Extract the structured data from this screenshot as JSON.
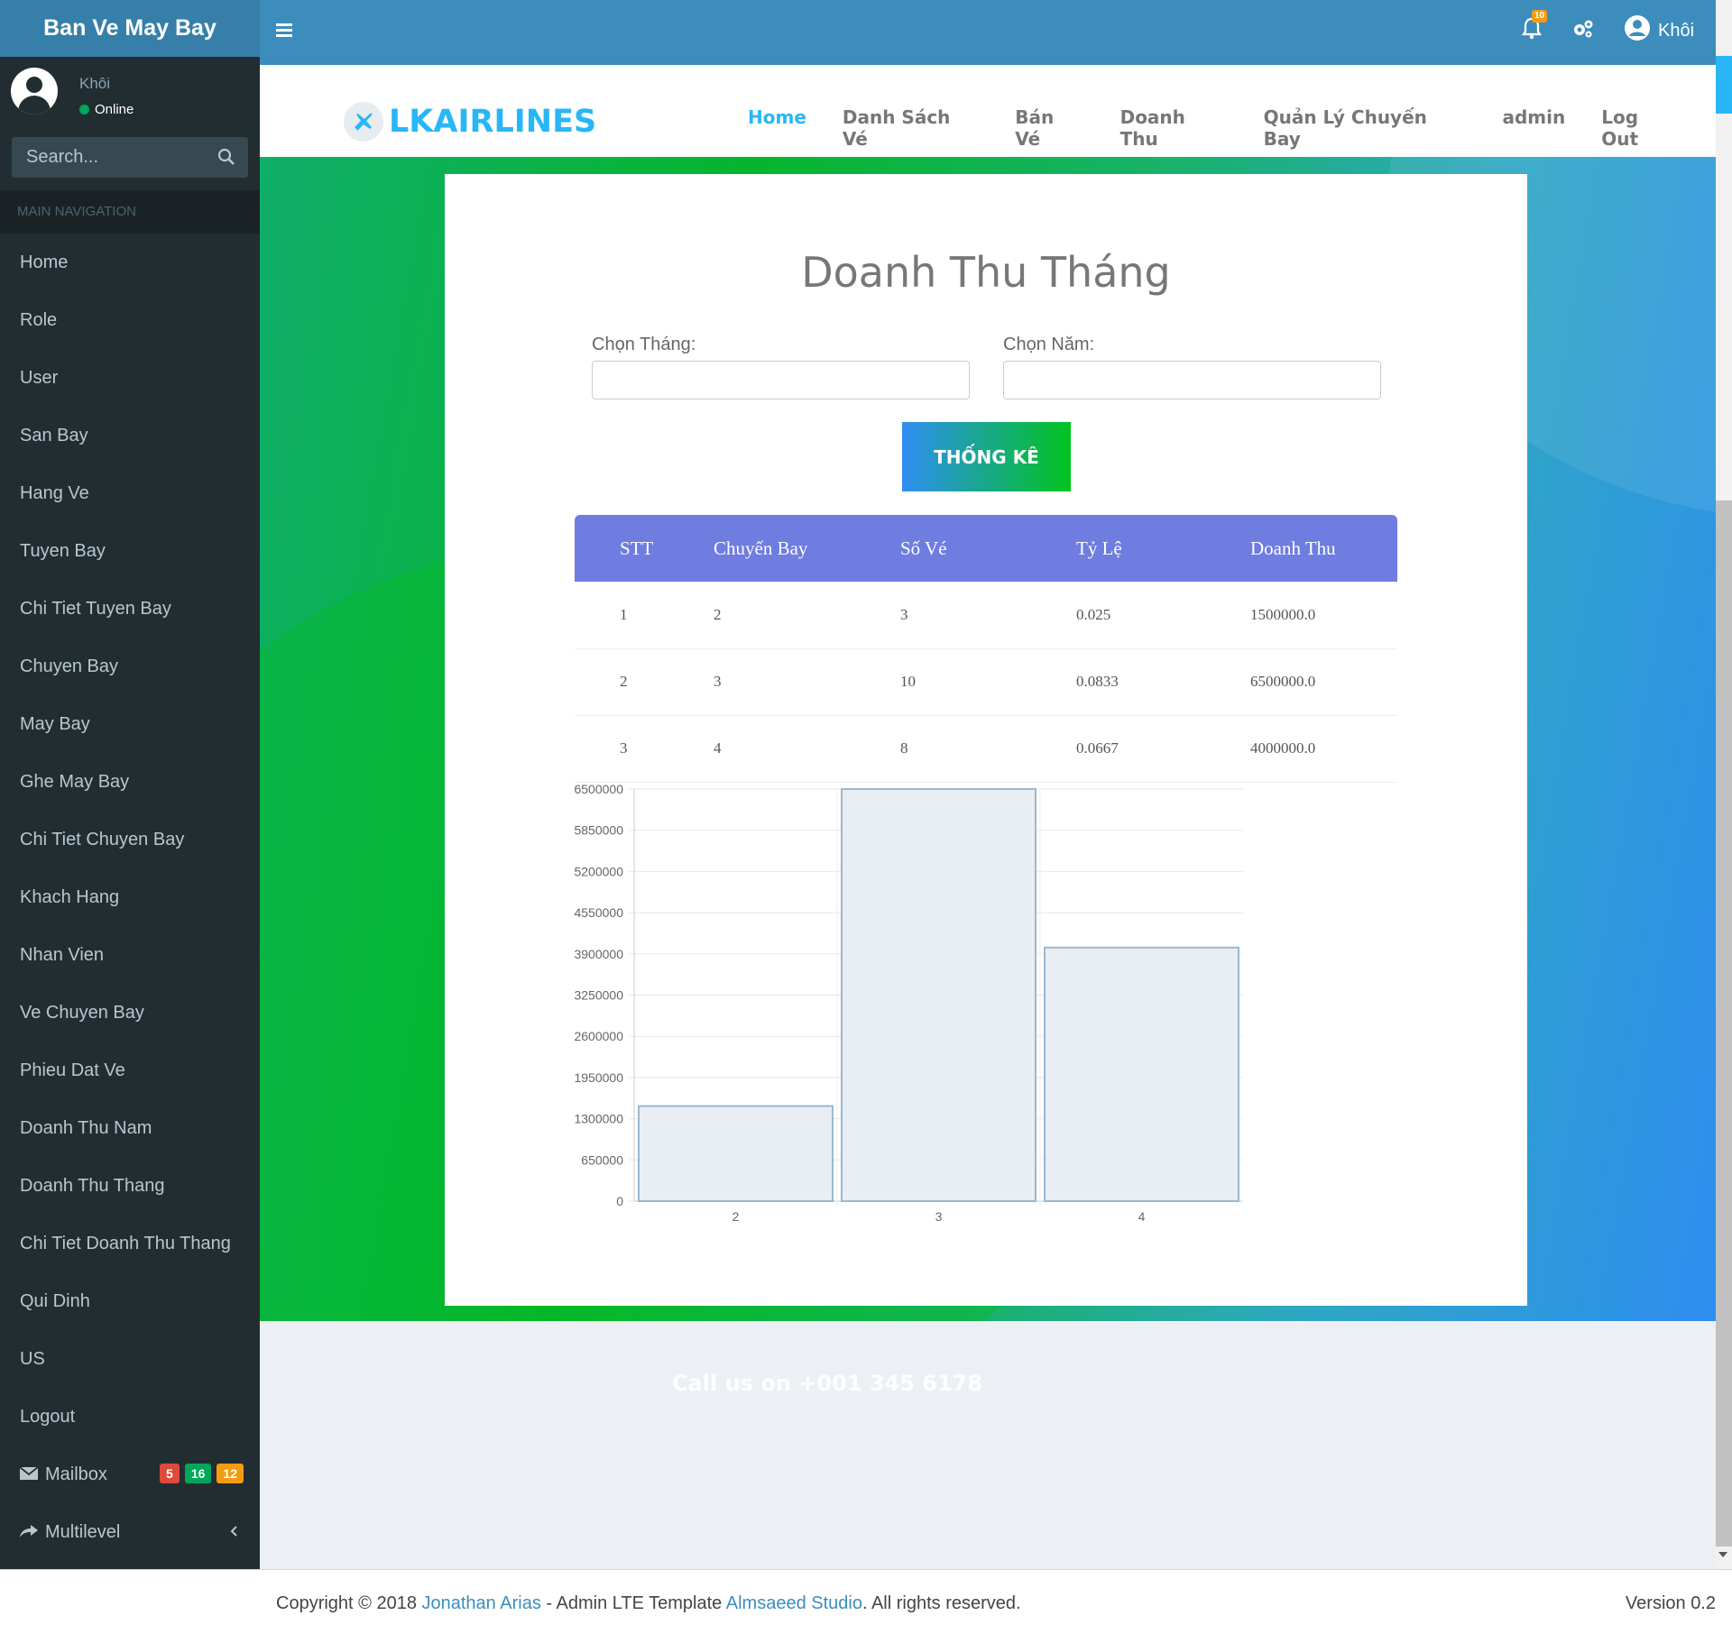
{
  "sidebar": {
    "brand": "Ban Ve May Bay",
    "user_name": "Khôi",
    "user_status": "Online",
    "search_placeholder": "Search...",
    "nav_header": "MAIN NAVIGATION",
    "items": [
      {
        "label": "Home"
      },
      {
        "label": "Role"
      },
      {
        "label": "User"
      },
      {
        "label": "San Bay"
      },
      {
        "label": "Hang Ve"
      },
      {
        "label": "Tuyen Bay"
      },
      {
        "label": "Chi Tiet Tuyen Bay"
      },
      {
        "label": "Chuyen Bay"
      },
      {
        "label": "May Bay"
      },
      {
        "label": "Ghe May Bay"
      },
      {
        "label": "Chi Tiet Chuyen Bay"
      },
      {
        "label": "Khach Hang"
      },
      {
        "label": "Nhan Vien"
      },
      {
        "label": "Ve Chuyen Bay"
      },
      {
        "label": "Phieu Dat Ve"
      },
      {
        "label": "Doanh Thu Nam"
      },
      {
        "label": "Doanh Thu Thang"
      },
      {
        "label": "Chi Tiet Doanh Thu Thang"
      },
      {
        "label": "Qui Dinh"
      },
      {
        "label": "US"
      },
      {
        "label": "Logout"
      }
    ],
    "mailbox": {
      "label": "Mailbox",
      "badges": [
        {
          "value": "5",
          "color": "#dd4b39"
        },
        {
          "value": "16",
          "color": "#00a65a"
        },
        {
          "value": "12",
          "color": "#f39c12"
        }
      ]
    },
    "multilevel": {
      "label": "Multilevel"
    }
  },
  "topbar": {
    "notifications_count": "10",
    "user_name": "Khôi"
  },
  "site_nav": {
    "logo": "LKAIRLINES",
    "links": [
      "Home",
      "Danh Sách Vé",
      "Bán Vé",
      "Doanh Thu",
      "Quản Lý Chuyến Bay",
      "admin",
      "Log Out"
    ]
  },
  "main": {
    "title": "Doanh Thu Tháng",
    "month_label": "Chọn Tháng:",
    "year_label": "Chọn Năm:",
    "month_value": "",
    "year_value": "",
    "submit_label": "THỐNG KÊ",
    "table": {
      "headers": [
        "STT",
        "Chuyến Bay",
        "Số Vé",
        "Tỷ Lệ",
        "Doanh Thu"
      ],
      "rows": [
        [
          "1",
          "2",
          "3",
          "0.025",
          "1500000.0"
        ],
        [
          "2",
          "3",
          "10",
          "0.0833",
          "6500000.0"
        ],
        [
          "3",
          "4",
          "8",
          "0.0667",
          "4000000.0"
        ]
      ]
    }
  },
  "chart_data": {
    "type": "bar",
    "categories": [
      "2",
      "3",
      "4"
    ],
    "values": [
      1500000,
      6500000,
      4000000
    ],
    "ylim": [
      0,
      6500000
    ],
    "yticks": [
      "0",
      "650000",
      "1300000",
      "1950000",
      "2600000",
      "3250000",
      "3900000",
      "4550000",
      "5200000",
      "5850000",
      "6500000"
    ],
    "bar_fill": "#e8eef3",
    "bar_stroke": "#9ab8d0"
  },
  "footer": {
    "call_us": "Call us on +001 345 6178",
    "copyright_prefix": "Copyright © 2018 ",
    "author": "Jonathan Arias",
    "middle": " - Admin LTE Template ",
    "studio": "Almsaeed Studio",
    "suffix": ". All rights reserved.",
    "version": "Version 0.2"
  }
}
